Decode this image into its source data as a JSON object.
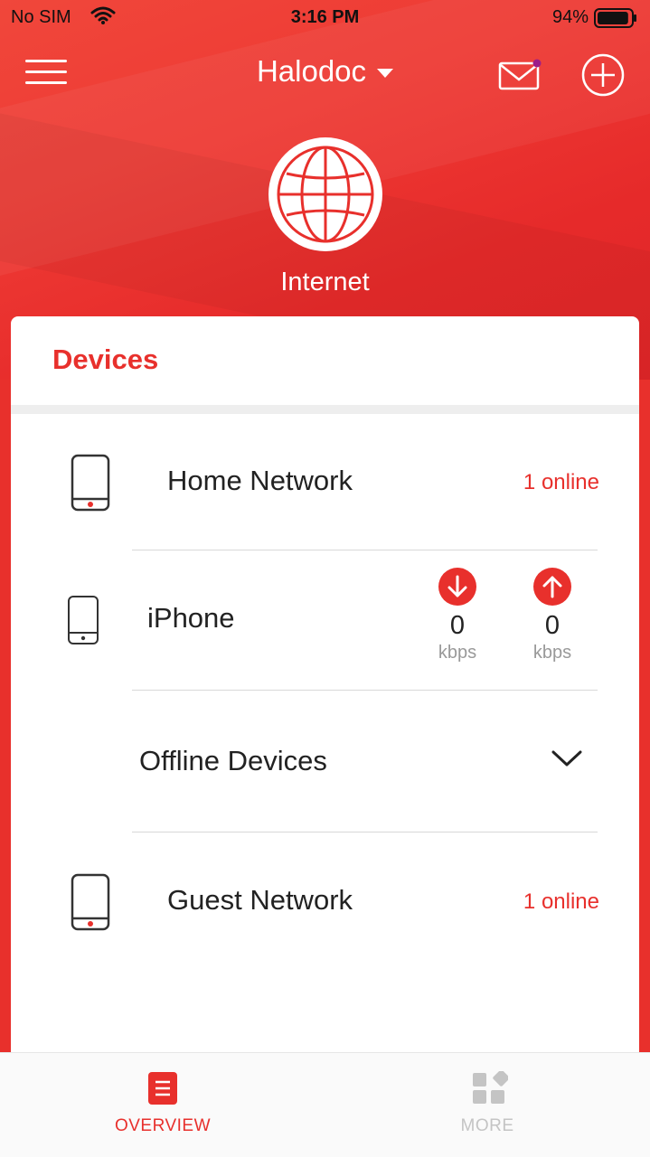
{
  "status_bar": {
    "carrier": "No SIM",
    "time": "3:16 PM",
    "battery_percent": "94%",
    "battery_level": 0.94
  },
  "header": {
    "title": "Halodoc",
    "menu_icon": "hamburger-menu-icon",
    "mail_icon": "mail-icon",
    "add_icon": "plus-circle-icon"
  },
  "internet": {
    "label": "Internet",
    "icon": "globe-icon"
  },
  "devices": {
    "title": "Devices",
    "home_network": {
      "label": "Home Network",
      "count": "1 online"
    },
    "iphone": {
      "label": "iPhone",
      "download": {
        "value": "0",
        "unit": "kbps"
      },
      "upload": {
        "value": "0",
        "unit": "kbps"
      }
    },
    "offline": {
      "label": "Offline Devices"
    },
    "guest_network": {
      "label": "Guest Network",
      "count": "1 online"
    }
  },
  "tabs": [
    {
      "label": "OVERVIEW",
      "active": true
    },
    {
      "label": "MORE",
      "active": false
    }
  ],
  "colors": {
    "accent": "#e8302c",
    "inactive": "#c4c4c4"
  }
}
